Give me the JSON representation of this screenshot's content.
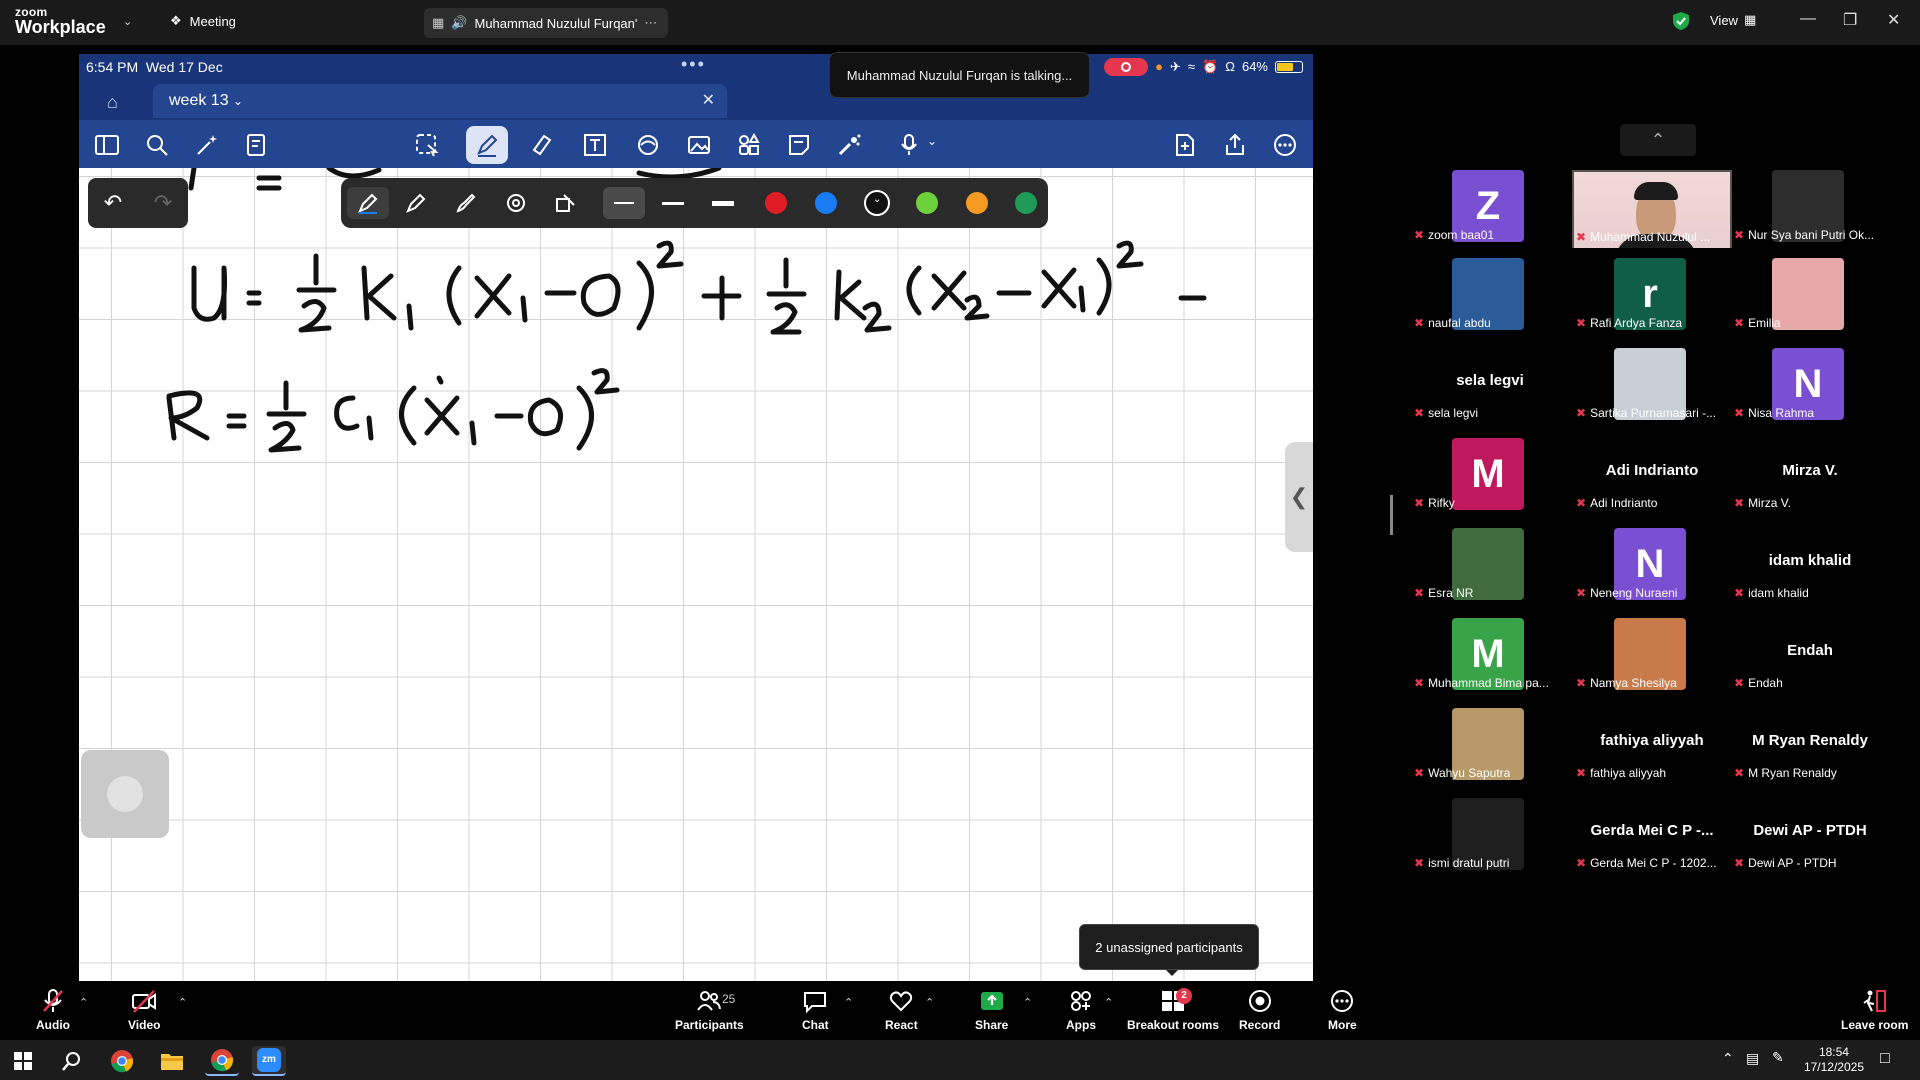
{
  "app": {
    "logo_line1": "zoom",
    "logo_line2": "Workplace",
    "meeting_label": "Meeting",
    "active_speaker_tab": "Muhammad Nuzulul Furqan'",
    "view_label": "View"
  },
  "ipad": {
    "time": "6:54 PM",
    "date": "Wed 17 Dec",
    "battery": "64%",
    "doc_tab": "week 13",
    "equations": [
      "U = ½ k₁ (x₁ − 0)² + ½ k₂ (x₂ − x₁)² +",
      "R = ½ c₁ (ẋ₁ − 0)²"
    ]
  },
  "colors": {
    "accent": "#244690",
    "status_bar": "#19357a",
    "red": "#e4364c",
    "swatches": [
      "#e01c24",
      "#1a7cf5",
      "#111111",
      "#6ed03b",
      "#f59a23",
      "#1f9b57"
    ]
  },
  "talking_notice": "Muhammad Nuzulul Furqan is talking...",
  "participants": [
    {
      "name": "zoom baa01",
      "initial": "Z",
      "color": "#7b4fd1"
    },
    {
      "name": "Muhammad Nuzulul ...",
      "video": true
    },
    {
      "name": "Nur Sya bani Putri Ok...",
      "photo": true,
      "color": "#2d2d2d"
    },
    {
      "name": "naufal abdu",
      "photo": true,
      "color": "#2a5c9a"
    },
    {
      "name": "Rafi Ardya Fanza",
      "initial": "r",
      "color": "#0f5e45"
    },
    {
      "name": "Emilia",
      "photo": true,
      "color": "#e7a9a8"
    },
    {
      "name": "sela legvi",
      "bigname": "sela legvi"
    },
    {
      "name": "Sartika Purnamasari -...",
      "photo": true,
      "color": "#c9cfd6"
    },
    {
      "name": "Nisa Rahma",
      "initial": "N",
      "color": "#7b4fd1"
    },
    {
      "name": "Rifky",
      "initial": "M",
      "color": "#c0185c"
    },
    {
      "name": "Adi Indrianto",
      "bigname": "Adi Indrianto"
    },
    {
      "name": "Mirza V.",
      "bigname": "Mirza V."
    },
    {
      "name": "Esra NR",
      "photo": true,
      "color": "#3f6b3f"
    },
    {
      "name": "Neneng Nuraeni",
      "initial": "N",
      "color": "#7b4fd1"
    },
    {
      "name": "idam khalid",
      "bigname": "idam khalid"
    },
    {
      "name": "Muhammad Bima pa...",
      "initial": "M",
      "color": "#39a34a"
    },
    {
      "name": "Namya Shesilya",
      "photo": true,
      "color": "#c97a4a"
    },
    {
      "name": "Endah",
      "bigname": "Endah"
    },
    {
      "name": "Wahyu Saputra",
      "photo": true,
      "color": "#b89a6a"
    },
    {
      "name": "fathiya aliyyah",
      "bigname": "fathiya aliyyah"
    },
    {
      "name": "M Ryan Renaldy",
      "bigname": "M Ryan Renaldy"
    },
    {
      "name": "ismi dratul putri",
      "photo": true,
      "color": "#1e1e1e"
    },
    {
      "name": "Gerda Mei C P - 1202...",
      "bigname": "Gerda Mei C P -..."
    },
    {
      "name": "Dewi AP - PTDH",
      "bigname": "Dewi AP - PTDH"
    }
  ],
  "tooltip": "2 unassigned participants",
  "bottom": {
    "audio": "Audio",
    "video": "Video",
    "participants": "Participants",
    "participants_count": "25",
    "chat": "Chat",
    "react": "React",
    "share": "Share",
    "apps": "Apps",
    "breakout": "Breakout rooms",
    "breakout_badge": "2",
    "record": "Record",
    "more": "More",
    "leave": "Leave room"
  },
  "taskbar": {
    "time": "18:54",
    "date": "17/12/2025"
  }
}
